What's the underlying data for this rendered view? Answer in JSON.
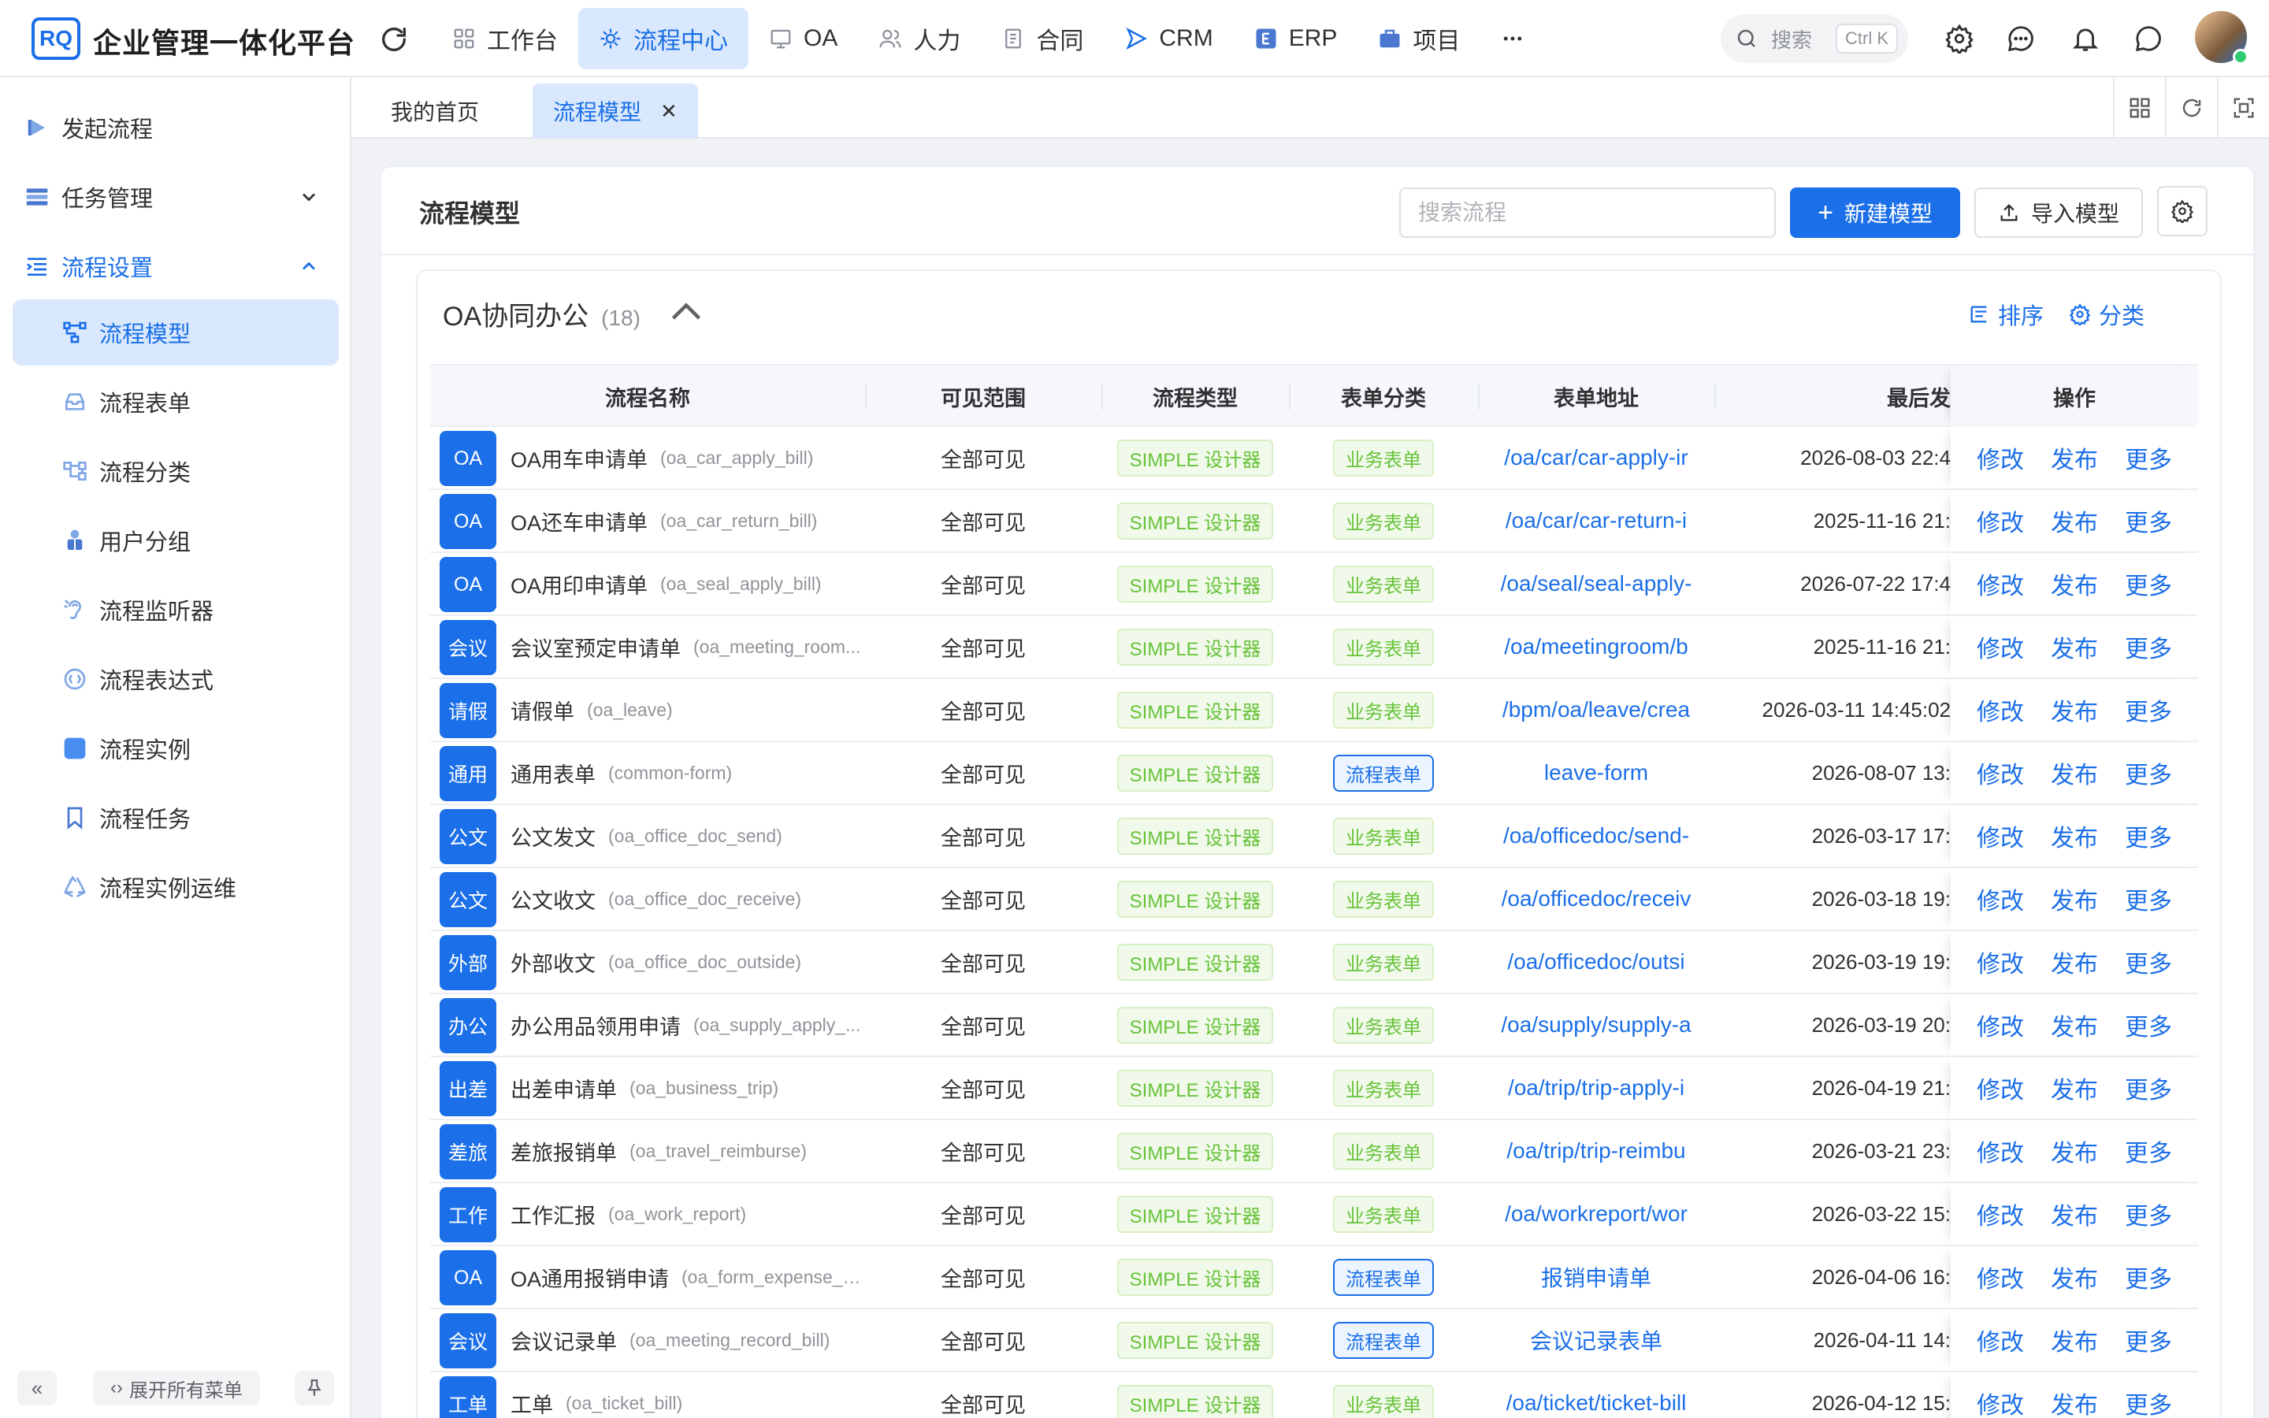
{
  "app": {
    "logo_text": "RQ",
    "title": "企业管理一体化平台"
  },
  "topnav": [
    {
      "label": "工作台",
      "icon": "dashboard-icon",
      "active": false
    },
    {
      "label": "流程中心",
      "icon": "workflow-icon",
      "active": true
    },
    {
      "label": "OA",
      "icon": "oa-icon",
      "active": false
    },
    {
      "label": "人力",
      "icon": "people-icon",
      "active": false
    },
    {
      "label": "合同",
      "icon": "contract-icon",
      "active": false
    },
    {
      "label": "CRM",
      "icon": "crm-icon",
      "active": false
    },
    {
      "label": "ERP",
      "icon": "erp-icon",
      "active": false
    },
    {
      "label": "项目",
      "icon": "briefcase-icon",
      "active": false
    }
  ],
  "header_search": {
    "placeholder": "搜索",
    "shortcut": "Ctrl K"
  },
  "sidebar": {
    "items": [
      {
        "label": "发起流程",
        "icon": "play-icon",
        "level": 1
      },
      {
        "label": "任务管理",
        "icon": "task-icon",
        "level": 1,
        "caret": "down"
      },
      {
        "label": "流程设置",
        "icon": "settings-list-icon",
        "level": 1,
        "caret": "up",
        "open": true
      },
      {
        "label": "流程模型",
        "icon": "model-icon",
        "level": 2,
        "selected": true
      },
      {
        "label": "流程表单",
        "icon": "form-icon",
        "level": 2
      },
      {
        "label": "流程分类",
        "icon": "category-icon",
        "level": 2
      },
      {
        "label": "用户分组",
        "icon": "user-group-icon",
        "level": 2
      },
      {
        "label": "流程监听器",
        "icon": "listener-icon",
        "level": 2
      },
      {
        "label": "流程表达式",
        "icon": "expression-icon",
        "level": 2
      },
      {
        "label": "流程实例",
        "icon": "instance-icon",
        "level": 2
      },
      {
        "label": "流程任务",
        "icon": "bookmark-icon",
        "level": 2
      },
      {
        "label": "流程实例运维",
        "icon": "recycle-icon",
        "level": 2
      }
    ],
    "expand_all": "展开所有菜单"
  },
  "tabs": [
    {
      "label": "我的首页",
      "active": false
    },
    {
      "label": "流程模型",
      "active": true,
      "closable": true
    }
  ],
  "page": {
    "title": "流程模型",
    "search_placeholder": "搜索流程",
    "new_button": "新建模型",
    "import_button": "导入模型"
  },
  "group": {
    "name": "OA协同办公",
    "count": "(18)",
    "sort_label": "排序",
    "category_label": "分类"
  },
  "table": {
    "columns": [
      "流程名称",
      "可见范围",
      "流程类型",
      "表单分类",
      "表单地址",
      "最后发",
      "操作"
    ],
    "actions": [
      "修改",
      "发布",
      "更多"
    ],
    "rows": [
      {
        "badge": "OA",
        "name": "OA用车申请单",
        "code": "(oa_car_apply_bill)",
        "scope": "全部可见",
        "type": "SIMPLE 设计器",
        "category": "业务表单",
        "category_style": "green",
        "address": "/oa/car/car-apply-ir",
        "time": "2026-08-03 22:4"
      },
      {
        "badge": "OA",
        "name": "OA还车申请单",
        "code": "(oa_car_return_bill)",
        "scope": "全部可见",
        "type": "SIMPLE 设计器",
        "category": "业务表单",
        "category_style": "green",
        "address": "/oa/car/car-return-i",
        "time": "2025-11-16 21:"
      },
      {
        "badge": "OA",
        "name": "OA用印申请单",
        "code": "(oa_seal_apply_bill)",
        "scope": "全部可见",
        "type": "SIMPLE 设计器",
        "category": "业务表单",
        "category_style": "green",
        "address": "/oa/seal/seal-apply-",
        "time": "2026-07-22 17:4"
      },
      {
        "badge": "会议",
        "name": "会议室预定申请单",
        "code": "(oa_meeting_room...",
        "scope": "全部可见",
        "type": "SIMPLE 设计器",
        "category": "业务表单",
        "category_style": "green",
        "address": "/oa/meetingroom/b",
        "time": "2025-11-16 21:"
      },
      {
        "badge": "请假",
        "name": "请假单",
        "code": "(oa_leave)",
        "scope": "全部可见",
        "type": "SIMPLE 设计器",
        "category": "业务表单",
        "category_style": "green",
        "address": "/bpm/oa/leave/crea",
        "time": "2026-03-11 14:45:02"
      },
      {
        "badge": "通用",
        "name": "通用表单",
        "code": "(common-form)",
        "scope": "全部可见",
        "type": "SIMPLE 设计器",
        "category": "流程表单",
        "category_style": "blue",
        "address": "leave-form",
        "time": "2026-08-07 13:"
      },
      {
        "badge": "公文",
        "name": "公文发文",
        "code": "(oa_office_doc_send)",
        "scope": "全部可见",
        "type": "SIMPLE 设计器",
        "category": "业务表单",
        "category_style": "green",
        "address": "/oa/officedoc/send-",
        "time": "2026-03-17 17:"
      },
      {
        "badge": "公文",
        "name": "公文收文",
        "code": "(oa_office_doc_receive)",
        "scope": "全部可见",
        "type": "SIMPLE 设计器",
        "category": "业务表单",
        "category_style": "green",
        "address": "/oa/officedoc/receiv",
        "time": "2026-03-18 19:"
      },
      {
        "badge": "外部",
        "name": "外部收文",
        "code": "(oa_office_doc_outside)",
        "scope": "全部可见",
        "type": "SIMPLE 设计器",
        "category": "业务表单",
        "category_style": "green",
        "address": "/oa/officedoc/outsi",
        "time": "2026-03-19 19:"
      },
      {
        "badge": "办公",
        "name": "办公用品领用申请",
        "code": "(oa_supply_apply_...",
        "scope": "全部可见",
        "type": "SIMPLE 设计器",
        "category": "业务表单",
        "category_style": "green",
        "address": "/oa/supply/supply-a",
        "time": "2026-03-19 20:"
      },
      {
        "badge": "出差",
        "name": "出差申请单",
        "code": "(oa_business_trip)",
        "scope": "全部可见",
        "type": "SIMPLE 设计器",
        "category": "业务表单",
        "category_style": "green",
        "address": "/oa/trip/trip-apply-i",
        "time": "2026-04-19 21:"
      },
      {
        "badge": "差旅",
        "name": "差旅报销单",
        "code": "(oa_travel_reimburse)",
        "scope": "全部可见",
        "type": "SIMPLE 设计器",
        "category": "业务表单",
        "category_style": "green",
        "address": "/oa/trip/trip-reimbu",
        "time": "2026-03-21 23:"
      },
      {
        "badge": "工作",
        "name": "工作汇报",
        "code": "(oa_work_report)",
        "scope": "全部可见",
        "type": "SIMPLE 设计器",
        "category": "业务表单",
        "category_style": "green",
        "address": "/oa/workreport/wor",
        "time": "2026-03-22 15:"
      },
      {
        "badge": "OA",
        "name": "OA通用报销申请",
        "code": "(oa_form_expense_a...",
        "scope": "全部可见",
        "type": "SIMPLE 设计器",
        "category": "流程表单",
        "category_style": "blue",
        "address": "报销申请单",
        "time": "2026-04-06 16:"
      },
      {
        "badge": "会议",
        "name": "会议记录单",
        "code": "(oa_meeting_record_bill)",
        "scope": "全部可见",
        "type": "SIMPLE 设计器",
        "category": "流程表单",
        "category_style": "blue",
        "address": "会议记录表单",
        "time": "2026-04-11 14:"
      },
      {
        "badge": "工单",
        "name": "工单",
        "code": "(oa_ticket_bill)",
        "scope": "全部可见",
        "type": "SIMPLE 设计器",
        "category": "业务表单",
        "category_style": "green",
        "address": "/oa/ticket/ticket-bill",
        "time": "2026-04-12 15:"
      }
    ]
  },
  "colors": {
    "primary": "#1b6fe8",
    "selected_bg": "#d9e8fc",
    "tag_green": "#67c23a"
  }
}
